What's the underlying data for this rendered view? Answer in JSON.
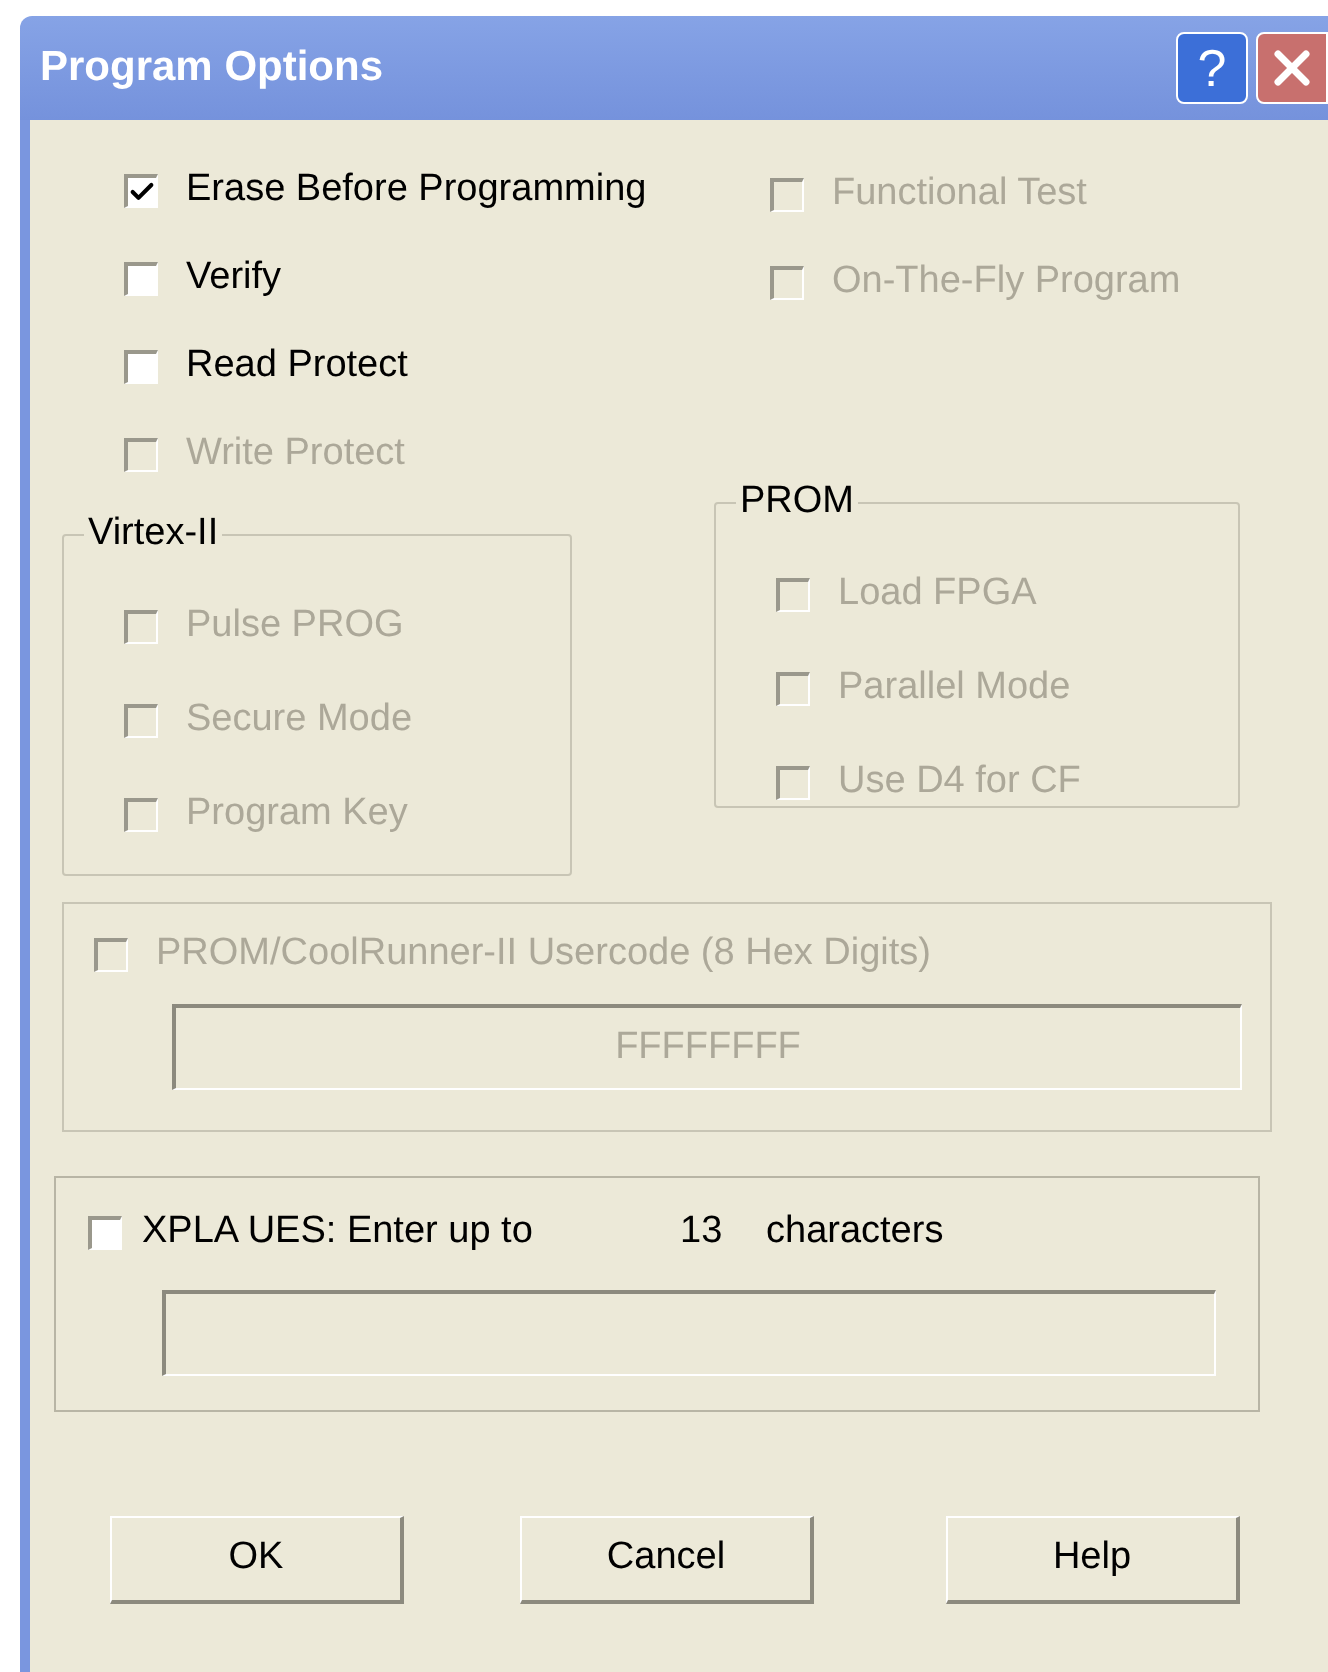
{
  "window": {
    "title": "Program Options",
    "help_button": "?"
  },
  "left_options": [
    {
      "label": "Erase Before Programming",
      "checked": true,
      "disabled": false
    },
    {
      "label": "Verify",
      "checked": false,
      "disabled": false
    },
    {
      "label": "Read Protect",
      "checked": false,
      "disabled": false
    },
    {
      "label": "Write Protect",
      "checked": false,
      "disabled": true
    }
  ],
  "right_options": [
    {
      "label": "Functional Test",
      "checked": false,
      "disabled": true
    },
    {
      "label": "On-The-Fly Program",
      "checked": false,
      "disabled": true
    }
  ],
  "virtex": {
    "title": "Virtex-II",
    "options": [
      {
        "label": "Pulse PROG",
        "checked": false,
        "disabled": true
      },
      {
        "label": "Secure Mode",
        "checked": false,
        "disabled": true
      },
      {
        "label": "Program Key",
        "checked": false,
        "disabled": true
      }
    ]
  },
  "prom": {
    "title": "PROM",
    "options": [
      {
        "label": "Load FPGA",
        "checked": false,
        "disabled": true
      },
      {
        "label": "Parallel Mode",
        "checked": false,
        "disabled": true
      },
      {
        "label": "Use D4 for CF",
        "checked": false,
        "disabled": true
      }
    ]
  },
  "usercode": {
    "label": "PROM/CoolRunner-II Usercode (8 Hex Digits)",
    "checked": false,
    "disabled": true,
    "value": "FFFFFFFF"
  },
  "xpla": {
    "label": "XPLA UES: Enter up to",
    "checked": false,
    "disabled": false,
    "count": "13",
    "unit": "characters"
  },
  "buttons": [
    "OK",
    "Cancel",
    "Help"
  ]
}
